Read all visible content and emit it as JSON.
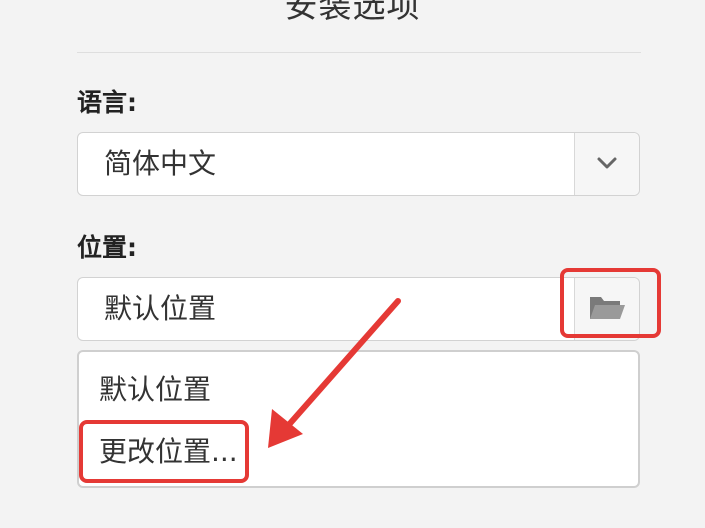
{
  "dialog": {
    "title": "安装选项"
  },
  "language": {
    "label": "语言:",
    "value": "简体中文",
    "dropdown_icon": "chevron-down-icon"
  },
  "location": {
    "label": "位置:",
    "value": "默认位置",
    "browse_icon": "folder-open-icon",
    "options": [
      "默认位置",
      "更改位置..."
    ]
  },
  "annotations": {
    "highlight_color": "#e53935",
    "arrow_icon": "red-arrow"
  }
}
